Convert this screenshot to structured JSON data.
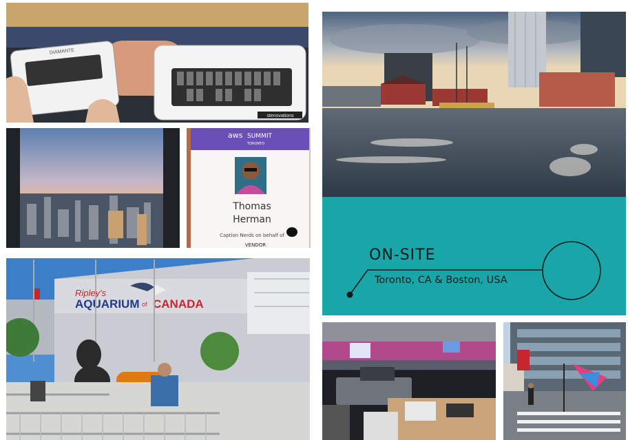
{
  "photos": {
    "stenotype": {
      "brand_left": "DIAMANTE",
      "brand_right": "stenovations"
    },
    "badge": {
      "logo": "aws",
      "event": "SUMMIT",
      "city": "TORONTO",
      "first_name": "Thomas",
      "last_name": "Herman",
      "company": "Caption Nerds on behalf of",
      "role": "VENDOR"
    },
    "aquarium": {
      "sign": "AQUARIUM",
      "sign_brand": "Ripley's",
      "sign_suffix": "CANADA",
      "sign_of": "of"
    }
  },
  "panel": {
    "heading": "ON-SITE",
    "location": "Toronto, CA & Boston, USA",
    "color": "#1aa6a8"
  }
}
